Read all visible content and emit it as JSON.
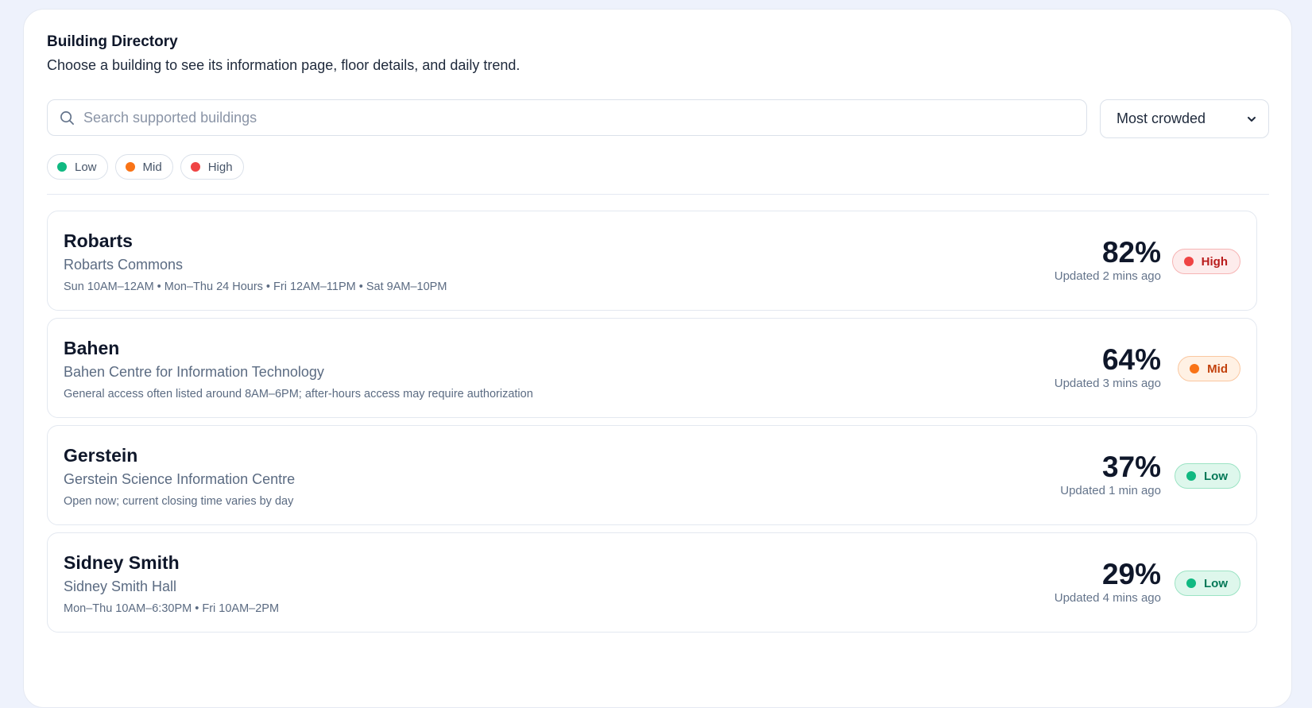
{
  "header": {
    "title": "Building Directory",
    "subtitle": "Choose a building to see its information page, floor details, and daily trend."
  },
  "search": {
    "placeholder": "Search supported buildings",
    "icon": "search-icon"
  },
  "sort": {
    "selected": "Most crowded",
    "icon": "chevron-down-icon"
  },
  "legend": [
    {
      "label": "Low",
      "color": "#10b981"
    },
    {
      "label": "Mid",
      "color": "#f97316"
    },
    {
      "label": "High",
      "color": "#ef4444"
    }
  ],
  "buildings": [
    {
      "name": "Robarts",
      "full_name": "Robarts Commons",
      "hours": "Sun 10AM–12AM • Mon–Thu 24 Hours • Fri 12AM–11PM • Sat 9AM–10PM",
      "occupancy": "82%",
      "updated": "Updated 2 mins ago",
      "level": "High"
    },
    {
      "name": "Bahen",
      "full_name": "Bahen Centre for Information Technology",
      "hours": "General access often listed around 8AM–6PM; after-hours access may require authorization",
      "occupancy": "64%",
      "updated": "Updated 3 mins ago",
      "level": "Mid"
    },
    {
      "name": "Gerstein",
      "full_name": "Gerstein Science Information Centre",
      "hours": "Open now; current closing time varies by day",
      "occupancy": "37%",
      "updated": "Updated 1 min ago",
      "level": "Low"
    },
    {
      "name": "Sidney Smith",
      "full_name": "Sidney Smith Hall",
      "hours": "Mon–Thu 10AM–6:30PM • Fri 10AM–2PM",
      "occupancy": "29%",
      "updated": "Updated 4 mins ago",
      "level": "Low"
    }
  ]
}
